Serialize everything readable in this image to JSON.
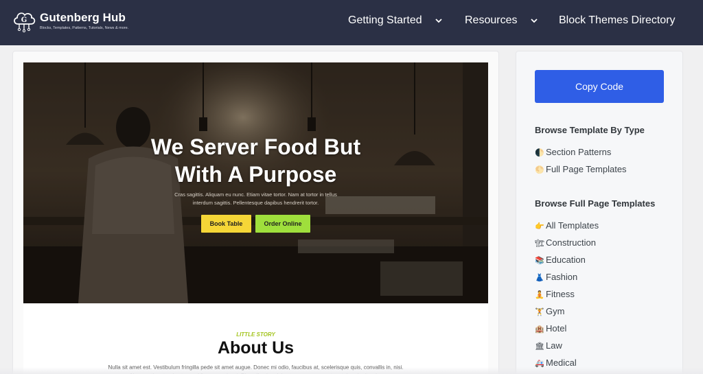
{
  "header": {
    "brand_title": "Gutenberg Hub",
    "brand_subtitle": "Blocks, Templates, Patterns, Tutorials, News & more.",
    "logo_letter": "G",
    "nav": [
      {
        "label": "Getting Started",
        "icon": "chevron-down-icon"
      },
      {
        "label": "Resources",
        "icon": "chevron-down-icon"
      },
      {
        "label": "Block Themes Directory"
      }
    ]
  },
  "hero": {
    "title_line1": "We Server Food But",
    "title_line2": "With A Purpose",
    "text": "Cras sagittis. Aliquam eu nunc. Etiam vitae tortor. Nam at tortor in tellus interdum sagittis. Pellentesque dapibus hendrerit tortor.",
    "button_book": "Book Table",
    "button_order": "Order Online"
  },
  "about": {
    "kicker": "LITTLE STORY",
    "title": "About Us",
    "text": "Nulla sit amet est. Vestibulum fringilla pede sit amet augue. Donec mi odio, faucibus at, scelerisque quis, convallis in, nisi. Nam pretium turpis et arcu. Vivamus quis mi. Phasellus leo dolor, tempus non, auctor et, hendrerit quis."
  },
  "sidebar": {
    "copy_button": "Copy Code",
    "heading_type": "Browse Template By Type",
    "types": [
      {
        "emoji": "🌓",
        "label": "Section Patterns"
      },
      {
        "emoji": "🌕",
        "label": "Full Page Templates"
      }
    ],
    "heading_full": "Browse Full Page Templates",
    "categories": [
      {
        "emoji": "👉",
        "label": "All Templates"
      },
      {
        "emoji": "🏗",
        "label": "Construction"
      },
      {
        "emoji": "📚",
        "label": "Education"
      },
      {
        "emoji": "👗",
        "label": "Fashion"
      },
      {
        "emoji": "🧘",
        "label": "Fitness"
      },
      {
        "emoji": "🏋",
        "label": "Gym"
      },
      {
        "emoji": "🏨",
        "label": "Hotel"
      },
      {
        "emoji": "🏛",
        "label": "Law"
      },
      {
        "emoji": "🚑",
        "label": "Medical"
      }
    ]
  },
  "colors": {
    "header_bg": "#2b3045",
    "accent_blue": "#2f5ee6",
    "button_yellow": "#f5d637",
    "button_green": "#9fdf3c",
    "kicker_green": "#a3c41d"
  }
}
